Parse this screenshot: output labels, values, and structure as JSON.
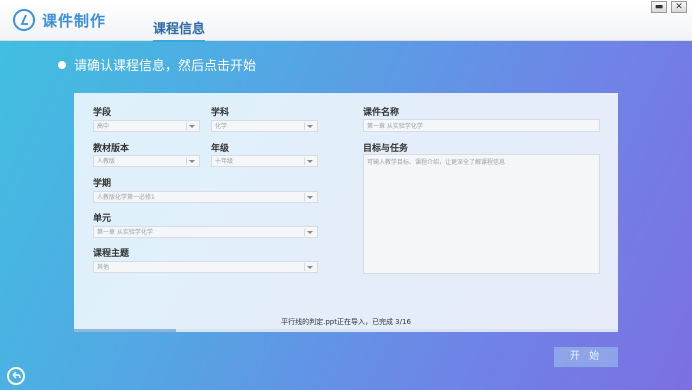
{
  "app": {
    "title": "课件制作"
  },
  "tabs": [
    {
      "label": "课程信息"
    }
  ],
  "window_controls": {
    "minimize": "▬",
    "close": "✕"
  },
  "heading": "请确认课程信息，然后点击开始",
  "form": {
    "stage": {
      "label": "学段",
      "value": "高中"
    },
    "subject": {
      "label": "学科",
      "value": "化学"
    },
    "edition": {
      "label": "教材版本",
      "value": "人教版"
    },
    "grade": {
      "label": "年级",
      "value": "十年级"
    },
    "term": {
      "label": "学期",
      "value": "人教版化学第一必修1"
    },
    "unit": {
      "label": "单元",
      "value": "第一章 从实验学化学"
    },
    "topic": {
      "label": "课程主题",
      "value": "其他"
    },
    "courseware_name": {
      "label": "课件名称",
      "value": "第一章 从实验学化学"
    },
    "goals": {
      "label": "目标与任务",
      "placeholder": "可输入教学目标、课程介绍，让更深全了解课程信息"
    }
  },
  "import_status": {
    "file": "平行线的判定.ppt",
    "text": "平行线的判定.ppt正在导入，已完成  3/16",
    "done": 3,
    "total": 16
  },
  "start_button": "开 始",
  "colors": {
    "accent": "#3aa7e0",
    "brand": "#3f8fd6"
  }
}
